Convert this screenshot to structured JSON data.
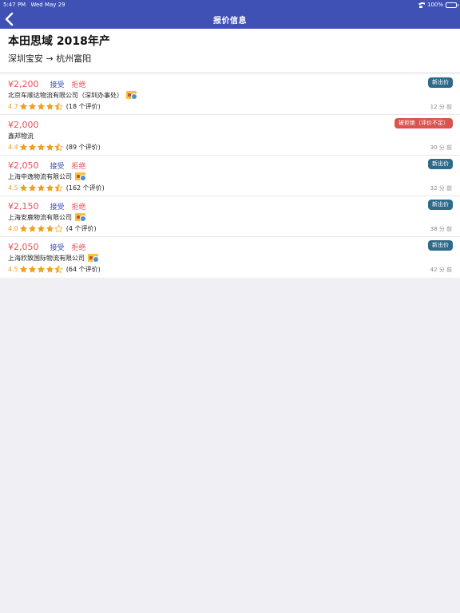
{
  "status": {
    "time": "5:47 PM",
    "date": "Wed May 29",
    "battery": "100%"
  },
  "nav": {
    "title": "报价信息"
  },
  "header": {
    "car": "本田思域 2018年产",
    "route": "深圳宝安 → 杭州富阳"
  },
  "actions": {
    "accept": "接受",
    "reject": "拒绝"
  },
  "colors": {
    "primary": "#3f51b5",
    "price": "#e8505b",
    "star": "#f0a020",
    "badge_new": "#2e6a8a",
    "badge_rejected": "#d9534f"
  },
  "quotes": [
    {
      "price": "¥2,200",
      "company": "北京车顺达物流有限公司（深圳办事处）",
      "score": "4.7",
      "rating": 4.5,
      "reviews": "(18 个评价)",
      "time": "12 分 前",
      "badge": "新出价",
      "badge_type": "new",
      "has_actions": true,
      "licensed": true
    },
    {
      "price": "¥2,000",
      "company": "鑫邦物流",
      "score": "4.4",
      "rating": 4.5,
      "reviews": "(89 个评价)",
      "time": "30 分 前",
      "badge": "被拒绝（评价不足）",
      "badge_type": "rejected",
      "has_actions": false,
      "licensed": false
    },
    {
      "price": "¥2,050",
      "company": "上海中逸物流有限公司",
      "score": "4.5",
      "rating": 4.5,
      "reviews": "(162 个评价)",
      "time": "32 分 前",
      "badge": "新出价",
      "badge_type": "new",
      "has_actions": true,
      "licensed": true
    },
    {
      "price": "¥2,150",
      "company": "上海安鹿物流有限公司",
      "score": "4.0",
      "rating": 4,
      "reviews": "(4 个评价)",
      "time": "38 分 前",
      "badge": "新出价",
      "badge_type": "new",
      "has_actions": true,
      "licensed": true
    },
    {
      "price": "¥2,050",
      "company": "上海欣致国际物流有限公司",
      "score": "4.5",
      "rating": 4.5,
      "reviews": "(64 个评价)",
      "time": "42 分 前",
      "badge": "新出价",
      "badge_type": "new",
      "has_actions": true,
      "licensed": true
    }
  ]
}
